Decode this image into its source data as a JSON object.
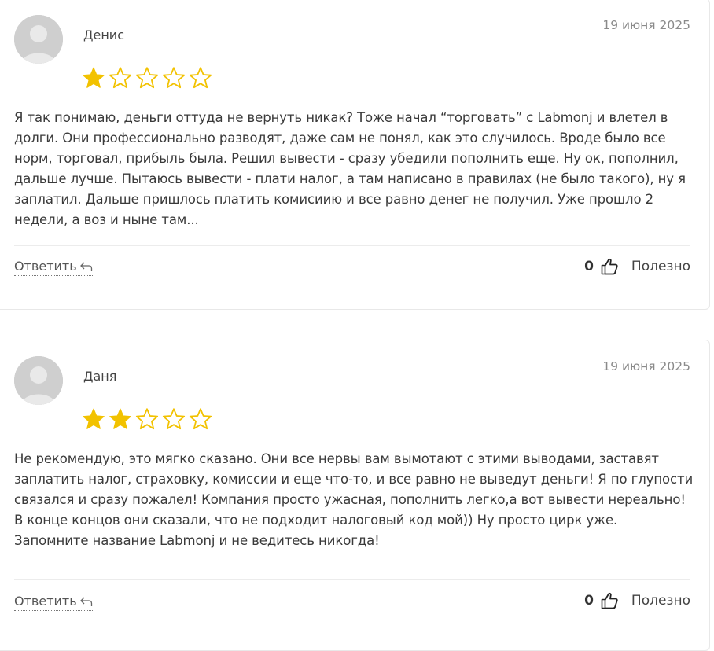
{
  "colors": {
    "star_filled": "#f2c200",
    "star_empty": "#f2c200",
    "text": "#3a3a3a",
    "date": "#8a8a8a"
  },
  "reviews": [
    {
      "author": "Денис",
      "date": "19 июня 2025",
      "rating": 1,
      "max_rating": 5,
      "text": "Я так понимаю, деньги оттуда не вернуть никак? Тоже начал “торговать” с Labmonj и влетел в долги. Они профессионально разводят, даже сам не понял, как это случилось. Вроде было все норм, торговал, прибыль была. Решил вывести - сразу убедили пополнить еще. Ну ок, пополнил, дальше лучше. Пытаюсь вывести - плати налог, а там написано в правилах (не было такого), ну я заплатил. Дальше пришлось платить комисиию и все равно денег не получил. Уже прошло 2 недели, а воз и ныне там...",
      "reply_label": "Ответить",
      "helpful_count": "0",
      "helpful_label": "Полезно"
    },
    {
      "author": "Даня",
      "date": "19 июня 2025",
      "rating": 2,
      "max_rating": 5,
      "text": "Не рекомендую, это мягко сказано. Они все нервы вам вымотают с этими выводами, заставят заплатить налог, страховку, комиссии и еще что-то, и все равно не выведут деньги! Я по глупости связался и сразу пожалел! Компания просто ужасная, пополнить легко,а вот вывести нереально! В конце концов они сказали, что не подходит налоговый код мой)) Ну просто цирк уже. Запомните название Labmonj и не ведитесь никогда!",
      "reply_label": "Ответить",
      "helpful_count": "0",
      "helpful_label": "Полезно"
    }
  ],
  "icons": {
    "avatar": "user-silhouette-icon",
    "star": "star-icon",
    "reply": "reply-arrow-icon",
    "thumb": "thumbs-up-icon"
  }
}
